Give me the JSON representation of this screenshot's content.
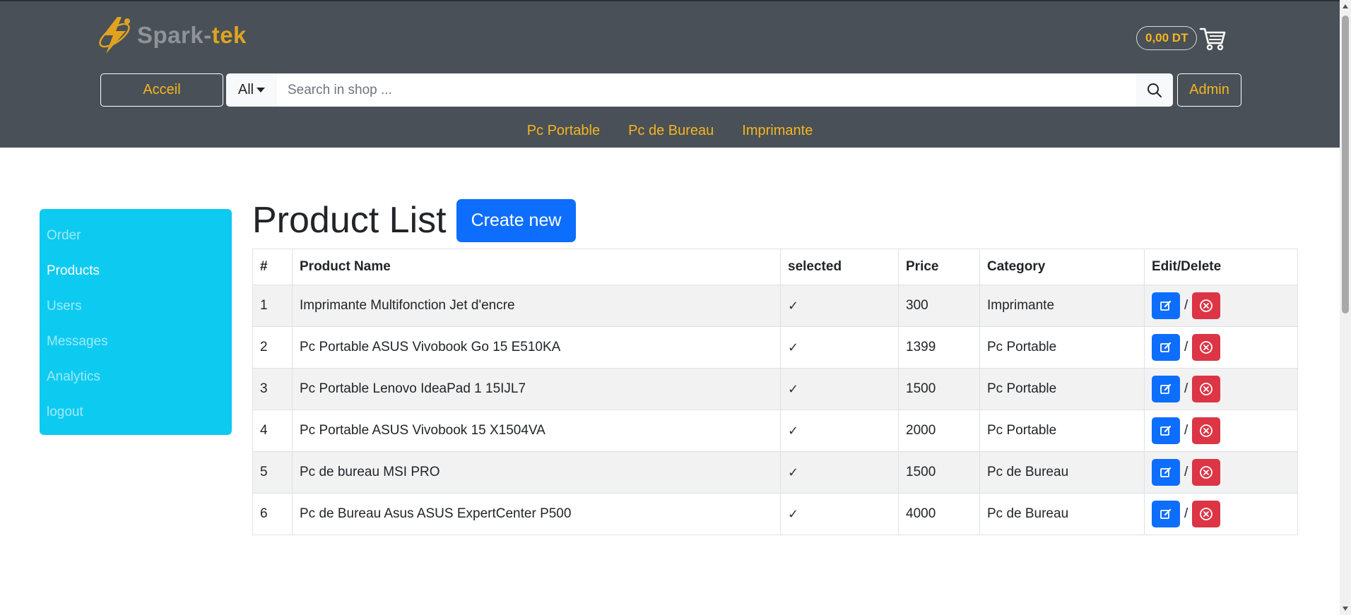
{
  "brand": {
    "name_part1": "Spark-",
    "name_part2": "tek"
  },
  "cart": {
    "total": "0,00 DT"
  },
  "header": {
    "home_button": "Acceil",
    "search": {
      "category": "All",
      "placeholder": "Search in shop ..."
    },
    "admin_button": "Admin",
    "categories": [
      "Pc Portable",
      "Pc de Bureau",
      "Imprimante"
    ]
  },
  "sidebar": {
    "items": [
      {
        "label": "Order"
      },
      {
        "label": "Products"
      },
      {
        "label": "Users"
      },
      {
        "label": "Messages"
      },
      {
        "label": "Analytics"
      },
      {
        "label": "logout"
      }
    ],
    "active": "Products"
  },
  "main": {
    "title": "Product List",
    "create_button": "Create new",
    "table": {
      "headers": [
        "#",
        "Product Name",
        "selected",
        "Price",
        "Category",
        "Edit/Delete"
      ],
      "rows": [
        {
          "id": "1",
          "name": "Imprimante Multifonction Jet d'encre",
          "selected": "✓",
          "price": "300",
          "category": "Imprimante"
        },
        {
          "id": "2",
          "name": "Pc Portable ASUS Vivobook Go 15 E510KA",
          "selected": "✓",
          "price": "1399",
          "category": "Pc Portable"
        },
        {
          "id": "3",
          "name": "Pc Portable Lenovo IdeaPad 1 15IJL7",
          "selected": "✓",
          "price": "1500",
          "category": "Pc Portable"
        },
        {
          "id": "4",
          "name": "Pc Portable ASUS Vivobook 15 X1504VA",
          "selected": "✓",
          "price": "2000",
          "category": "Pc Portable"
        },
        {
          "id": "5",
          "name": "Pc de bureau MSI PRO",
          "selected": "✓",
          "price": "1500",
          "category": "Pc de Bureau"
        },
        {
          "id": "6",
          "name": "Pc de Bureau Asus ASUS ExpertCenter P500",
          "selected": "✓",
          "price": "4000",
          "category": "Pc de Bureau"
        }
      ],
      "separator": "/"
    }
  },
  "colors": {
    "header_bg": "#495057",
    "accent": "#f5b61e",
    "sidebar_bg": "#0dcaf0",
    "primary": "#0d6efd",
    "danger": "#dc3545"
  }
}
